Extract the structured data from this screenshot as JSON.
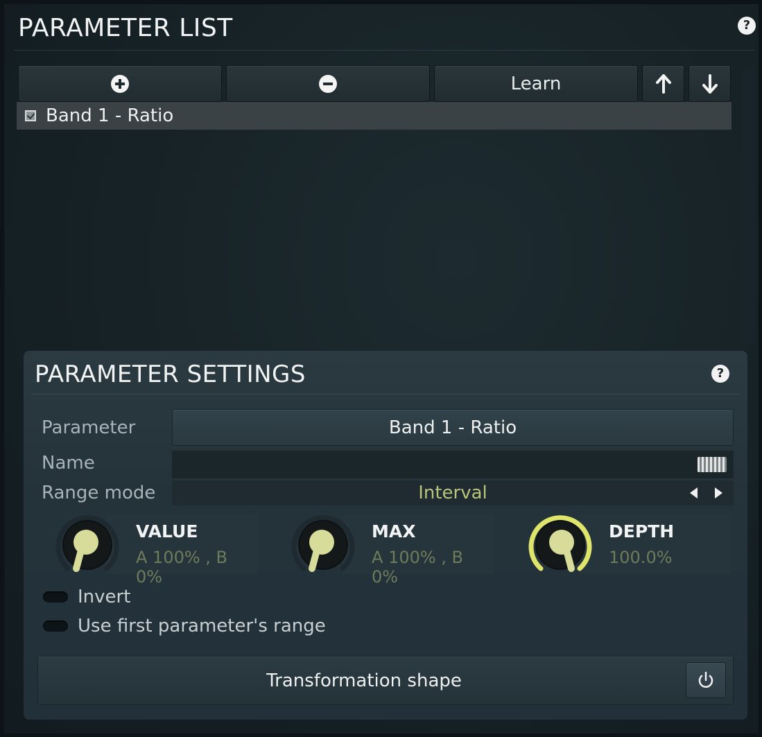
{
  "parameter_list": {
    "title": "PARAMETER LIST",
    "help_icon": "question-mark-icon",
    "toolbar": {
      "add_icon": "plus-circle-icon",
      "remove_icon": "minus-circle-icon",
      "learn_label": "Learn",
      "up_icon": "arrow-up-icon",
      "down_icon": "arrow-down-icon"
    },
    "items": [
      {
        "label": "Band 1 - Ratio",
        "checked": true
      }
    ]
  },
  "parameter_settings": {
    "title": "PARAMETER SETTINGS",
    "help_icon": "question-mark-icon",
    "parameter_label": "Parameter",
    "parameter_value": "Band 1 - Ratio",
    "name_label": "Name",
    "name_value": "",
    "range_mode_label": "Range mode",
    "range_mode_value": "Interval",
    "knobs": [
      {
        "title": "VALUE",
        "value": "A 100% , B 0%"
      },
      {
        "title": "MAX",
        "value": "A 100% , B 0%"
      },
      {
        "title": "DEPTH",
        "value": "100.0%"
      }
    ],
    "invert_label": "Invert",
    "invert_on": false,
    "use_first_range_label": "Use first parameter's range",
    "use_first_range_on": false,
    "transformation_shape_label": "Transformation shape",
    "power_icon": "power-icon"
  },
  "colors": {
    "accent_knob": "#d8dc9a",
    "active_ring": "#dfe46a",
    "value_text": "#6f7c5c",
    "range_text": "#b9c37a"
  }
}
